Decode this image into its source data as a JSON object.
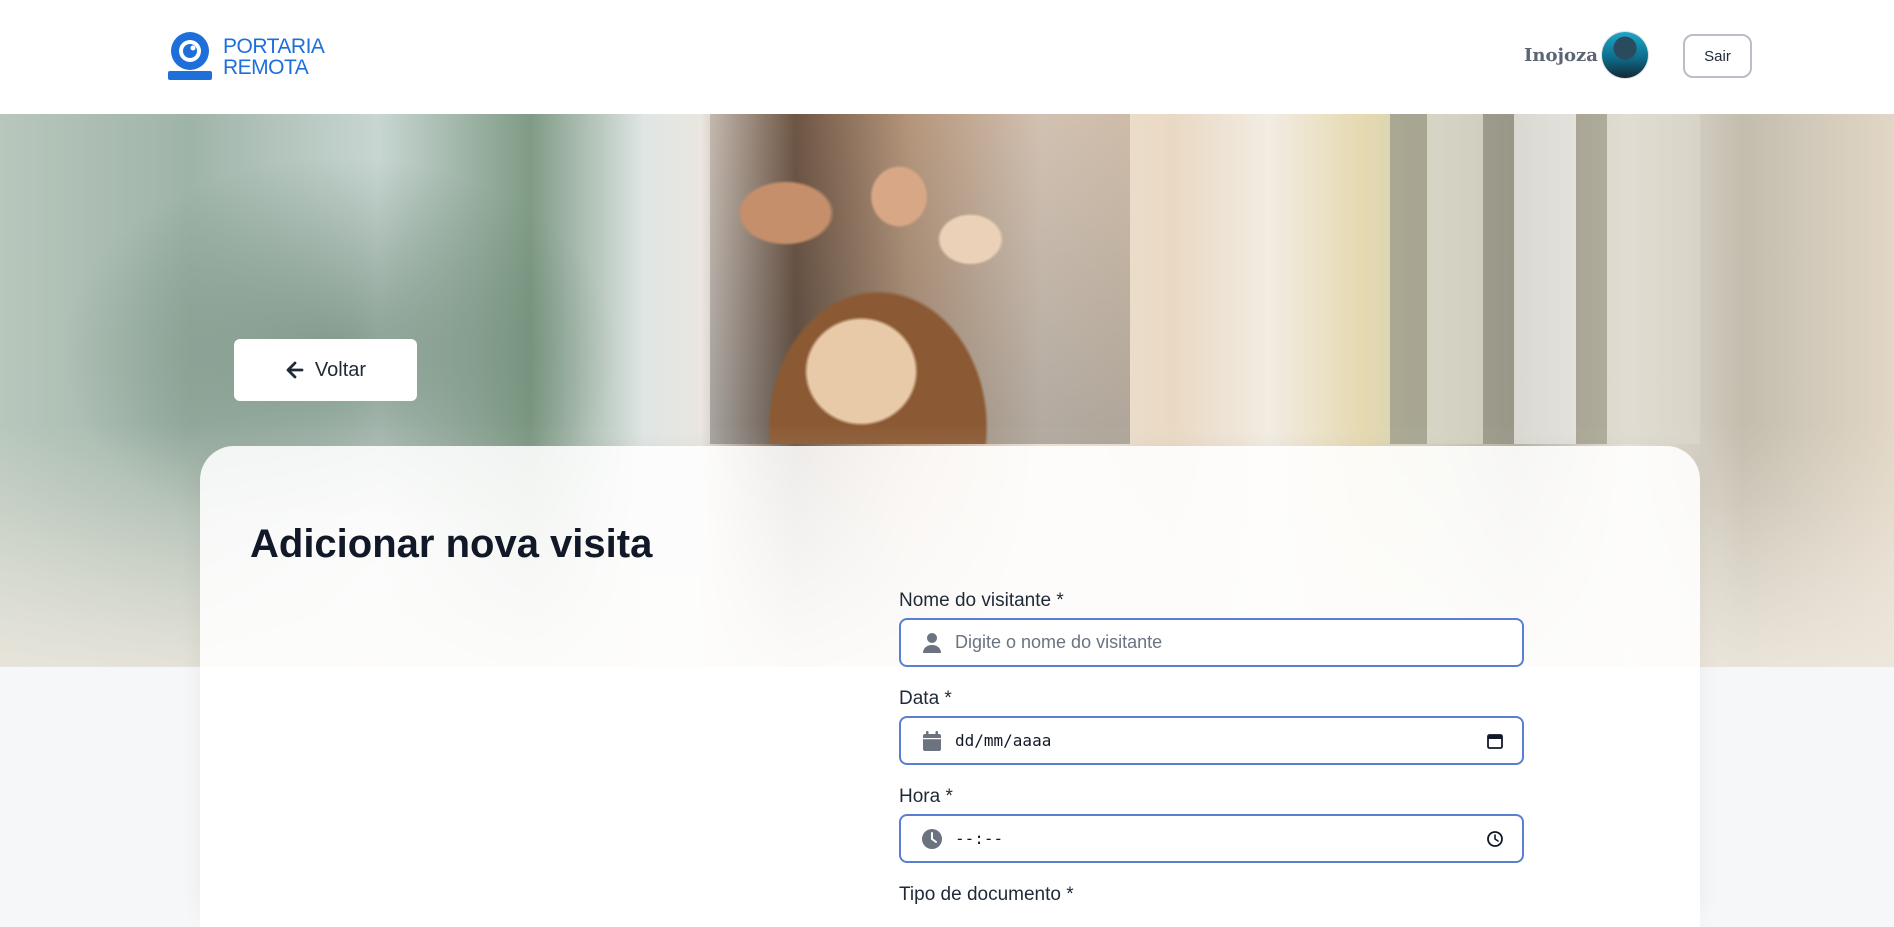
{
  "header": {
    "logo_line1": "PORTARIA",
    "logo_line2": "REMOTA",
    "user_name": "Inojoza",
    "logout_label": "Sair"
  },
  "hero": {
    "back_label": "Voltar"
  },
  "form": {
    "title": "Adicionar nova visita",
    "visitor_name": {
      "label": "Nome do visitante *",
      "placeholder": "Digite o nome do visitante",
      "icon": "user-icon"
    },
    "date": {
      "label": "Data *",
      "value_mask": "dd/mm/aaaa",
      "icon": "calendar-icon"
    },
    "time": {
      "label": "Hora *",
      "value_mask": "--:--",
      "icon": "clock-icon"
    },
    "document_type": {
      "label": "Tipo de documento *"
    }
  },
  "colors": {
    "brand_blue": "#1e6fd9",
    "input_border": "#5a7fd2",
    "title": "#111827"
  }
}
